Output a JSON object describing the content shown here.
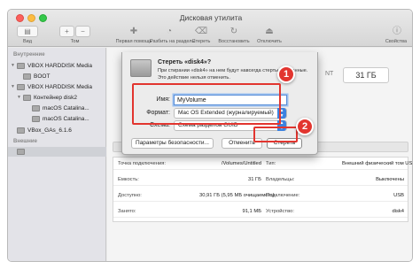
{
  "window": {
    "title": "Дисковая утилита"
  },
  "toolbar": {
    "view_label": "Вид",
    "volume_label": "Том",
    "first_aid_label": "Первая помощь",
    "partition_label": "Разбить на разделы",
    "erase_label": "Стереть",
    "restore_label": "Восстановить",
    "unmount_label": "Отключить",
    "info_label": "Свойства",
    "add_symbol": "+",
    "remove_symbol": "−"
  },
  "sidebar": {
    "internal_header": "Внутренние",
    "external_header": "Внешние",
    "items": [
      {
        "label": "VBOX HARDDISK Media"
      },
      {
        "label": "BOOT"
      },
      {
        "label": "VBOX HARDDISK Media"
      },
      {
        "label": "Контейнер disk2"
      },
      {
        "label": "macOS Catalina..."
      },
      {
        "label": "macOS Catalina..."
      },
      {
        "label": "VBox_GAs_6.1.6"
      }
    ]
  },
  "disk_header": {
    "tail_text": "NT",
    "size": "31 ГБ"
  },
  "erase_sheet": {
    "title": "Стереть «disk4»?",
    "description": "При стирании «disk4» на нем будут навсегда стерты все данные. Это действие нельзя отменить.",
    "name_label": "Имя:",
    "name_value": "MyVolume",
    "format_label": "Формат:",
    "format_value": "Mac OS Extended (журналируемый)",
    "scheme_label": "Схема:",
    "scheme_value": "Схема разделов GUID",
    "security_button": "Параметры безопасности...",
    "cancel_button": "Отменить",
    "erase_button": "Стереть"
  },
  "annotations": {
    "badge1": "1",
    "badge2": "2",
    "highlight_color": "#e2352f"
  },
  "info_table": [
    {
      "k1": "Точка подключения:",
      "v1": "/Volumes/Untitled",
      "k2": "Тип:",
      "v2": "Внешний физический том USB"
    },
    {
      "k1": "Емкость:",
      "v1": "31 ГБ",
      "k2": "Владельцы:",
      "v2": "Выключены"
    },
    {
      "k1": "Доступно:",
      "v1": "30,91 ГБ (5,95 МБ очищаемого)",
      "k2": "Подключение:",
      "v2": "USB"
    },
    {
      "k1": "Занято:",
      "v1": "91,1 МБ",
      "k2": "Устройство:",
      "v2": "disk4"
    }
  ]
}
